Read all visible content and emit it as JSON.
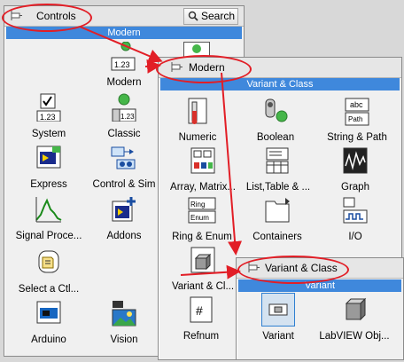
{
  "controls_palette": {
    "title": "Controls",
    "search_label": "Search",
    "band_label": "Modern",
    "items": [
      {
        "label": "Modern",
        "icon": "modern-icon"
      },
      {
        "label": "System",
        "icon": "system-icon"
      },
      {
        "label": "Classic",
        "icon": "classic-icon"
      },
      {
        "label": "Express",
        "icon": "express-icon"
      },
      {
        "label": "Control & Sim",
        "icon": "control-sim-icon"
      },
      {
        "label": "Signal Proce...",
        "icon": "signal-processing-icon"
      },
      {
        "label": "Addons",
        "icon": "addons-icon"
      },
      {
        "label": "Select a Ctl...",
        "icon": "select-control-icon"
      },
      {
        "label": "Arduino",
        "icon": "arduino-icon"
      },
      {
        "label": "Vision",
        "icon": "vision-icon"
      }
    ]
  },
  "modern_palette": {
    "title": "Modern",
    "band_label": "Variant & Class",
    "items": [
      {
        "label": "Numeric",
        "icon": "numeric-icon"
      },
      {
        "label": "Boolean",
        "icon": "boolean-icon"
      },
      {
        "label": "String & Path",
        "icon": "string-path-icon"
      },
      {
        "label": "Array, Matrix...",
        "icon": "array-matrix-icon"
      },
      {
        "label": "List,Table & ...",
        "icon": "list-table-icon"
      },
      {
        "label": "Graph",
        "icon": "graph-icon"
      },
      {
        "label": "Ring & Enum",
        "icon": "ring-enum-icon"
      },
      {
        "label": "Containers",
        "icon": "containers-icon"
      },
      {
        "label": "I/O",
        "icon": "io-icon"
      },
      {
        "label": "Variant & Cl...",
        "icon": "variant-class-icon"
      },
      {
        "label": "Refnum",
        "icon": "refnum-icon"
      }
    ]
  },
  "variant_palette": {
    "title": "Variant & Class",
    "band_label": "Variant",
    "items": [
      {
        "label": "Variant",
        "icon": "variant-icon"
      },
      {
        "label": "LabVIEW Obj...",
        "icon": "labview-object-icon"
      }
    ]
  },
  "icon_text": {
    "numeric_box": "1.23",
    "string_box_top": "abc",
    "string_box_bottom": "Path",
    "ring": "Ring",
    "enum": "Enum",
    "refnum": "#"
  },
  "colors": {
    "band": "#3f88dc",
    "annotation": "#e21e26"
  }
}
